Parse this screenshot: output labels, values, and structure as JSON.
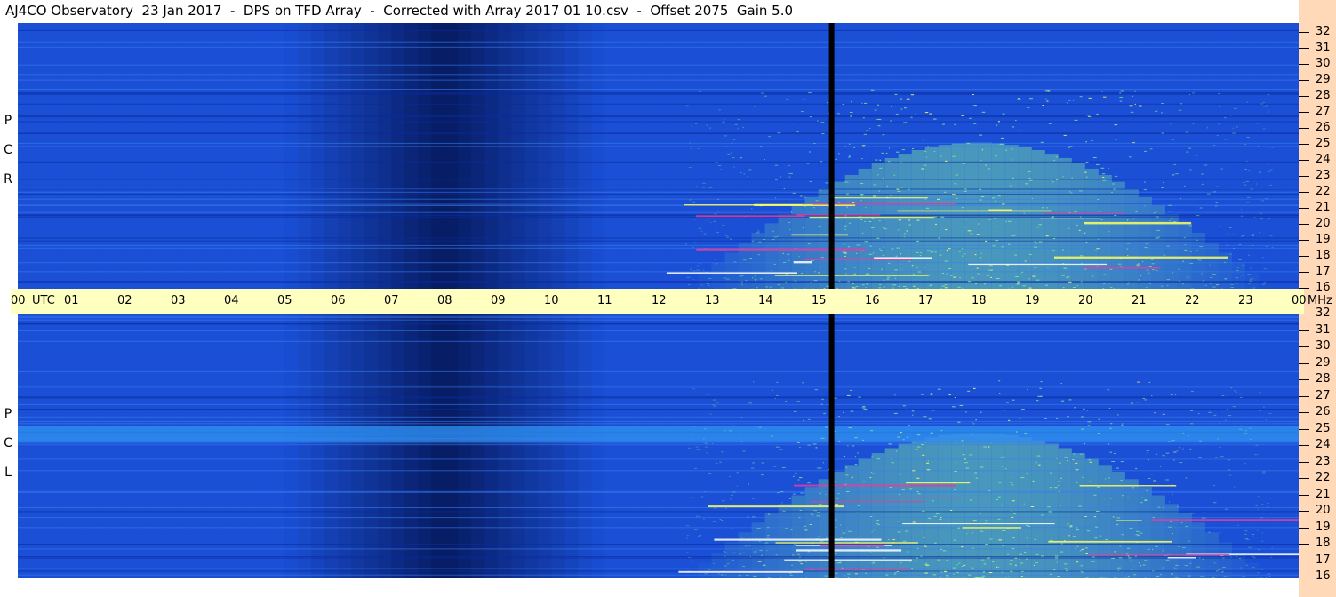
{
  "title": "AJ4CO Observatory  23 Jan 2017  -  DPS on TFD Array  -  Corrected with Array 2017 01 10.csv  -  Offset 2075  Gain 5.0",
  "chart_data": {
    "type": "heatmap",
    "panels": [
      {
        "name": "R C P",
        "polarization": [
          "R",
          "C",
          "P"
        ]
      },
      {
        "name": "L C P",
        "polarization": [
          "L",
          "C",
          "P"
        ]
      }
    ],
    "x_axis": {
      "unit_label": "UTC",
      "ticks": [
        "00",
        "01",
        "02",
        "03",
        "04",
        "05",
        "06",
        "07",
        "08",
        "09",
        "10",
        "11",
        "12",
        "13",
        "14",
        "15",
        "16",
        "17",
        "18",
        "19",
        "20",
        "21",
        "22",
        "23",
        "00"
      ],
      "range": [
        0,
        24
      ]
    },
    "y_axis": {
      "unit_label": "MHz",
      "ticks": [
        "32",
        "31",
        "30",
        "29",
        "28",
        "27",
        "26",
        "25",
        "24",
        "23",
        "22",
        "21",
        "20",
        "19",
        "18",
        "17",
        "16"
      ],
      "range": [
        16,
        32
      ]
    },
    "colors": {
      "quiet": "#1a4fd6",
      "deep": "#000a3a",
      "active": "#7fe8a0",
      "hot": "#ffff60",
      "gap": "#000000",
      "axis_band": "#ffffc0",
      "freq_band": "#ffd9b8"
    },
    "data_gap_utc": 15.25,
    "active_window_utc": [
      12.5,
      23.5
    ],
    "darkest_window_utc": [
      5,
      11
    ]
  }
}
